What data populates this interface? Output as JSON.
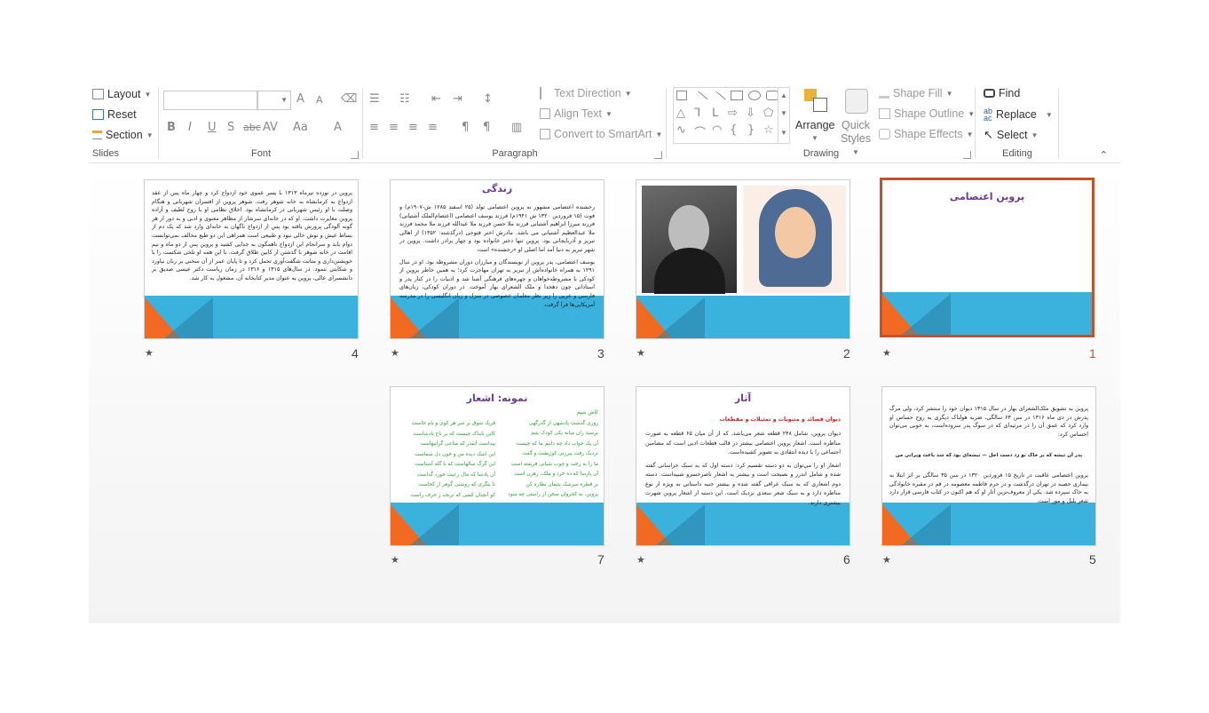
{
  "ribbon": {
    "slides": {
      "label": "Slides",
      "layout": "Layout",
      "reset": "Reset",
      "section": "Section"
    },
    "font": {
      "label": "Font",
      "bold": "B",
      "italic": "I",
      "underline": "U",
      "shadow": "S",
      "strike": "abc",
      "spacing": "AV",
      "case": "Aa",
      "color": "A",
      "grow": "A",
      "shrink": "A"
    },
    "paragraph": {
      "label": "Paragraph",
      "text_direction": "Text Direction",
      "align_text": "Align Text",
      "convert_smartart": "Convert to SmartArt"
    },
    "drawing": {
      "label": "Drawing",
      "arrange": "Arrange",
      "quick_styles_1": "Quick",
      "quick_styles_2": "Styles",
      "shape_fill": "Shape Fill",
      "shape_outline": "Shape Outline",
      "shape_effects": "Shape Effects"
    },
    "editing": {
      "label": "Editing",
      "find": "Find",
      "replace": "Replace",
      "select": "Select"
    }
  },
  "slides": [
    {
      "number": "1",
      "title": "پروین اعتصامی"
    },
    {
      "number": "2"
    },
    {
      "number": "3",
      "title": "زندگی",
      "body": [
        "رخشنده اعتصامی مشهور به پروین اعتصامی تولد (۲۵ اسفند ۱۲۸۵ ش-۱۹۰۷م) و فوت (۱۵ فروردین ۱۳۲۰ ش ۱۹۴۱م) فرزند یوسف اعتصامی (اعتصام‌الملک آشتیانی) فرزند میرزا ابراهیم آشتیانی فرزند ملا حسن فرزند ملا عبدالله فرزند ملا محمد فرزند ملا عبدالعظیم آشتیانی می باشد. مادرش اختر فتوحی (درگذشته: ۱۳۵۲) از اهالی تبریز و آذربایجانی بود. پروین تنها دختر خانواده بود و چهار برادر داشت. پروین در شهر تبریز به دنیا آمد اما اصلی او «رخشنده» است",
        "یوسف اعتصامی، پدر پروین از نویسندگان و مبارزان دوران مشروطه بود. او در سال ۱۲۹۱ به همراه خانواده‌اش از تبریز به تهران مهاجرت کرد؛ به همین خاطر پروین از کودکی با مشروطه‌خواهان و چهره‌های فرهنگی آشنا شد و ادبیات را در کنار پدر و استادانی چون دهخدا و ملک الشعرای بهار آموخت. در دوران کودکی، زبان‌های فارسی و عربی را زیر نظر معلمان خصوصی در منزل و زبان انگلیسی را در مدرسه آمریکایی‌ها فرا گرفت."
      ]
    },
    {
      "number": "4",
      "body": [
        "پروین در نوزده تیرماه ۱۳۱۳ با پسر عموی خود ازدواج کرد و چهار ماه پس از عقد ازدواج به کرمانشاه به خانه شوهر رفت. شوهر پروین از افسران شهربانی و هنگام وصلت با او رئیس شهربانی در کرمانشاه بود. اخلاق نظامی او با روح لطیف و آزاده پروین مغایرت داشت. او که در خانه‌ای سرشار از مظاهر معنوی و ادبی و به دور از هر گونه آلودگی پرورش یافته بود پس از ازدواج ناگهان به خانه‌ای وارد شد که یک دم از بساط عیش و نوش خالی نبود و طبیعی است همراهی این دو طبع مخالف نمی‌توانست دوام یابد و سرانجام این ازدواج ناهمگون به جدایی کشید و پروین پس از دو ماه و نیم اقامت در خانه شوهر با گذشتن از کابین طلاق گرفت. با این همه او تلخی شکست را با خویشتن‌داری و متانت شگفت‌آوری تحمل کرد و تا پایان عمر از آن سخنی بر زبان نیاورد و شکایتی ننمود. در سال‌های ۱۳۱۵ و ۱۳۱۶ در زمان ریاست دکتر عیسی صدیق بر دانشسرای عالی، پروین به عنوان مدیر کتابخانه آن، مشغول به کار شد."
      ]
    },
    {
      "number": "5",
      "body": [
        "پروین به تشویق ملک‌الشعرای بهار در سال ۱۳۱۵ دیوان خود را منتشر کرد، ولی مرگ پدرش در دی ماه ۱۳۱۶ در سن ۶۳ سالگی، ضربه هولناک دیگری به روح حساس او وارد کرد که عمق آن را در مرثیه‌ای که در سوگ پدر سروده‌است، به خوبی می‌توان احساس کرد:",
        "پدر آن تیشه که بر خاک تو زد دست اجل — تیشه‌ای بود که شد باعث ویرانی من",
        "پروین اعتصامی عاقبت در تاریخ ۱۵ فروردین ۱۳۲۰ در سن ۳۵ سالگی بر اثر ابتلا به بیماری حصبه در تهران درگذشت و در حرم فاطمه معصومه در قم در مقبره خانوادگی به خاک سپرده شد. یکی از معروف‌ترین آثار او که هم اکنون در کتاب فارسی قرار دارد شعر بلبل و مور است."
      ]
    },
    {
      "number": "6",
      "title": "آثار",
      "subtitle": "دیوان قصائد و مثنویات و تمثیلات و مقطعات",
      "body": [
        "دیوان پروین، شامل ۲۴۸ قطعه شعر می‌باشد، که از آن میان ۶۵ قطعه به صورت مناظره است. اشعار پروین اعتصامی بیشتر در قالب قطعات ادبی است که مضامین اجتماعی را با دیده انتقادی به تصویر کشیده‌است.",
        "اشعار او را می‌توان به دو دسته تقسیم کرد: دسته اول که به سبک خراسانی گفته شده و شامل اندرز و نصیحت است و بیشتر به اشعار ناصرخسرو شبیه‌است. دسته دوم اشعاری که به سبک عراقی گفته شده و بیشتر جنبه داستانی به ویژه از نوع مناظره دارد و به سبک شعر سعدی نزدیک است. این دسته از اشعار پروین شهرت بیشتری دارند."
      ]
    },
    {
      "number": "7",
      "title": "نمونه: اشعار",
      "verses_right": [
        "کاش بتپیم",
        "روزی گذشت پادشهی از گذرگهی",
        "پرسید زان میانه یکی کودک یتیم",
        "آن یک جواب داد چه دانیم ما که چیست",
        "نزدیک رفت پیرزنی کوژپشت و گفت",
        "ما را به رخت و چوب شبانی فریفته است",
        "آن پارسا که ده خرد و ملک، رهزن است",
        "بر قطره سرشک یتیمان نظاره کن",
        "پروین، به کجروان سخن از راستی چه سود"
      ],
      "verses_left": [
        "فریاد شوق بر سر هر کوی و بام خاست",
        "کاین تابناک چیست که بر تاج پادشاست",
        "پیداست آنقدر که متاعی گرانبهاست",
        "این اشک دیده من و خون دل شماست",
        "این گرگ سالهاست که با گله آشناست",
        "آن پادشا که مال رعیت خورد گداست",
        "تا بنگری که روشنی گوهر از کجاست",
        "کو آنچنان کسی که نرنجد ز حرف راست"
      ]
    }
  ]
}
